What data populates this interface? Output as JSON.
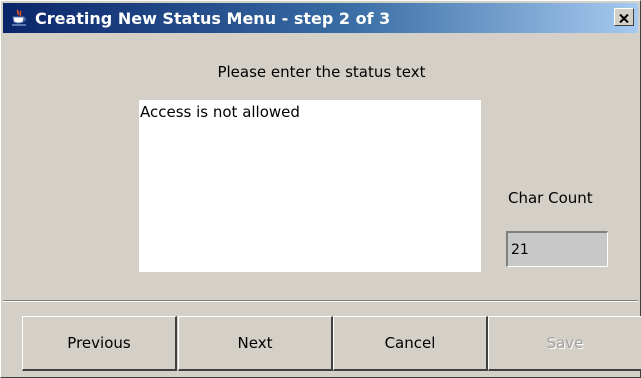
{
  "window": {
    "title": "Creating New Status Menu - step 2 of 3",
    "title_icon": "java-cup-icon",
    "close_icon": "close-icon",
    "colors": {
      "titlebar_start": "#0a246a",
      "titlebar_end": "#a6caf0",
      "background": "#d4d0c8"
    }
  },
  "form": {
    "prompt": "Please enter the status text",
    "status_text": "Access is not allowed",
    "char_count_label": "Char Count",
    "char_count_value": "21"
  },
  "buttons": {
    "previous": "Previous",
    "next": "Next",
    "cancel": "Cancel",
    "save": "Save",
    "save_enabled": false
  }
}
